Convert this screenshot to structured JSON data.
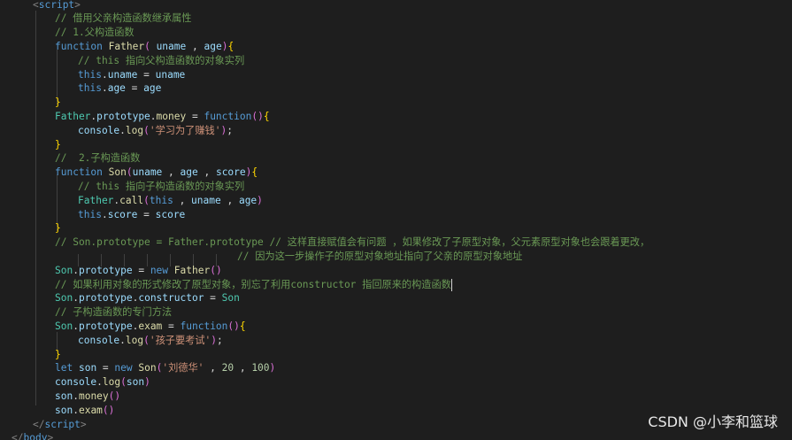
{
  "code": {
    "lines": [
      [
        [
          "tag",
          "<"
        ],
        [
          "tagname",
          "script"
        ],
        [
          "tag",
          ">"
        ]
      ],
      [
        [
          "comment",
          "// 借用父亲构造函数继承属性"
        ]
      ],
      [
        [
          "comment",
          "// 1.父构造函数"
        ]
      ],
      [
        [
          "kw",
          "function"
        ],
        [
          "punc",
          " "
        ],
        [
          "fn",
          "Father"
        ],
        [
          "paren",
          "("
        ],
        [
          "punc",
          " "
        ],
        [
          "var",
          "uname"
        ],
        [
          "punc",
          " , "
        ],
        [
          "var",
          "age"
        ],
        [
          "paren",
          ")"
        ],
        [
          "brace",
          "{"
        ]
      ],
      [
        [
          "comment",
          "// this 指向父构造函数的对象实列"
        ]
      ],
      [
        [
          "kw",
          "this"
        ],
        [
          "punc",
          "."
        ],
        [
          "var",
          "uname"
        ],
        [
          "punc",
          " = "
        ],
        [
          "var",
          "uname"
        ]
      ],
      [
        [
          "kw",
          "this"
        ],
        [
          "punc",
          "."
        ],
        [
          "var",
          "age"
        ],
        [
          "punc",
          " = "
        ],
        [
          "var",
          "age"
        ]
      ],
      [
        [
          "brace",
          "}"
        ]
      ],
      [
        [
          "type",
          "Father"
        ],
        [
          "punc",
          "."
        ],
        [
          "var",
          "prototype"
        ],
        [
          "punc",
          "."
        ],
        [
          "fn",
          "money"
        ],
        [
          "punc",
          " = "
        ],
        [
          "kw",
          "function"
        ],
        [
          "paren",
          "()"
        ],
        [
          "brace",
          "{"
        ]
      ],
      [
        [
          "var",
          "console"
        ],
        [
          "punc",
          "."
        ],
        [
          "fn",
          "log"
        ],
        [
          "paren",
          "("
        ],
        [
          "str",
          "'学习为了赚钱'"
        ],
        [
          "paren",
          ")"
        ],
        [
          "punc",
          ";"
        ]
      ],
      [
        [
          "brace",
          "}"
        ]
      ],
      [
        [
          "comment",
          "//  2.子构造函数"
        ]
      ],
      [
        [
          "kw",
          "function"
        ],
        [
          "punc",
          " "
        ],
        [
          "fn",
          "Son"
        ],
        [
          "paren",
          "("
        ],
        [
          "var",
          "uname"
        ],
        [
          "punc",
          " , "
        ],
        [
          "var",
          "age"
        ],
        [
          "punc",
          " , "
        ],
        [
          "var",
          "score"
        ],
        [
          "paren",
          ")"
        ],
        [
          "brace",
          "{"
        ]
      ],
      [
        [
          "comment",
          "// this 指向子构造函数的对象实列"
        ]
      ],
      [
        [
          "type",
          "Father"
        ],
        [
          "punc",
          "."
        ],
        [
          "fn",
          "call"
        ],
        [
          "paren",
          "("
        ],
        [
          "kw",
          "this"
        ],
        [
          "punc",
          " , "
        ],
        [
          "var",
          "uname"
        ],
        [
          "punc",
          " , "
        ],
        [
          "var",
          "age"
        ],
        [
          "paren",
          ")"
        ]
      ],
      [
        [
          "kw",
          "this"
        ],
        [
          "punc",
          "."
        ],
        [
          "var",
          "score"
        ],
        [
          "punc",
          " = "
        ],
        [
          "var",
          "score"
        ]
      ],
      [
        [
          "brace",
          "}"
        ]
      ],
      [
        [
          "comment",
          "// Son.prototype = Father.prototype // 这样直接赋值会有问题 ，如果修改了子原型对象，父元素原型对象也会跟着更改，"
        ]
      ],
      [
        [
          "comment",
          "// 因为这一步操作子的原型对象地址指向了父亲的原型对象地址"
        ]
      ],
      [
        [
          "type",
          "Son"
        ],
        [
          "punc",
          "."
        ],
        [
          "var",
          "prototype"
        ],
        [
          "punc",
          " = "
        ],
        [
          "kw",
          "new"
        ],
        [
          "punc",
          " "
        ],
        [
          "fn",
          "Father"
        ],
        [
          "paren",
          "()"
        ]
      ],
      [
        [
          "comment",
          "// 如果利用对象的形式修改了原型对象，别忘了利用constructor 指回原来的构造函数"
        ]
      ],
      [
        [
          "type",
          "Son"
        ],
        [
          "punc",
          "."
        ],
        [
          "var",
          "prototype"
        ],
        [
          "punc",
          "."
        ],
        [
          "var",
          "constructor"
        ],
        [
          "punc",
          " = "
        ],
        [
          "type",
          "Son"
        ]
      ],
      [
        [
          "comment",
          "// 子构造函数的专门方法"
        ]
      ],
      [
        [
          "type",
          "Son"
        ],
        [
          "punc",
          "."
        ],
        [
          "var",
          "prototype"
        ],
        [
          "punc",
          "."
        ],
        [
          "fn",
          "exam"
        ],
        [
          "punc",
          " = "
        ],
        [
          "kw",
          "function"
        ],
        [
          "paren",
          "()"
        ],
        [
          "brace",
          "{"
        ]
      ],
      [
        [
          "var",
          "console"
        ],
        [
          "punc",
          "."
        ],
        [
          "fn",
          "log"
        ],
        [
          "paren",
          "("
        ],
        [
          "str",
          "'孩子要考试'"
        ],
        [
          "paren",
          ")"
        ],
        [
          "punc",
          ";"
        ]
      ],
      [
        [
          "brace",
          "}"
        ]
      ],
      [
        [
          "kw",
          "let"
        ],
        [
          "punc",
          " "
        ],
        [
          "var",
          "son"
        ],
        [
          "punc",
          " = "
        ],
        [
          "kw",
          "new"
        ],
        [
          "punc",
          " "
        ],
        [
          "fn",
          "Son"
        ],
        [
          "paren",
          "("
        ],
        [
          "str",
          "'刘德华'"
        ],
        [
          "punc",
          " , "
        ],
        [
          "num",
          "20"
        ],
        [
          "punc",
          " , "
        ],
        [
          "num",
          "100"
        ],
        [
          "paren",
          ")"
        ]
      ],
      [
        [
          "var",
          "console"
        ],
        [
          "punc",
          "."
        ],
        [
          "fn",
          "log"
        ],
        [
          "paren",
          "("
        ],
        [
          "var",
          "son"
        ],
        [
          "paren",
          ")"
        ]
      ],
      [
        [
          "var",
          "son"
        ],
        [
          "punc",
          "."
        ],
        [
          "fn",
          "money"
        ],
        [
          "paren",
          "()"
        ]
      ],
      [
        [
          "var",
          "son"
        ],
        [
          "punc",
          "."
        ],
        [
          "fn",
          "exam"
        ],
        [
          "paren",
          "()"
        ]
      ],
      [
        [
          "tag",
          "</"
        ],
        [
          "tagname",
          "script"
        ],
        [
          "tag",
          ">"
        ]
      ],
      [
        [
          "tag",
          "</"
        ],
        [
          "tagname",
          "body"
        ],
        [
          "tag",
          ">"
        ]
      ]
    ]
  },
  "watermark": "CSDN @小李和篮球"
}
